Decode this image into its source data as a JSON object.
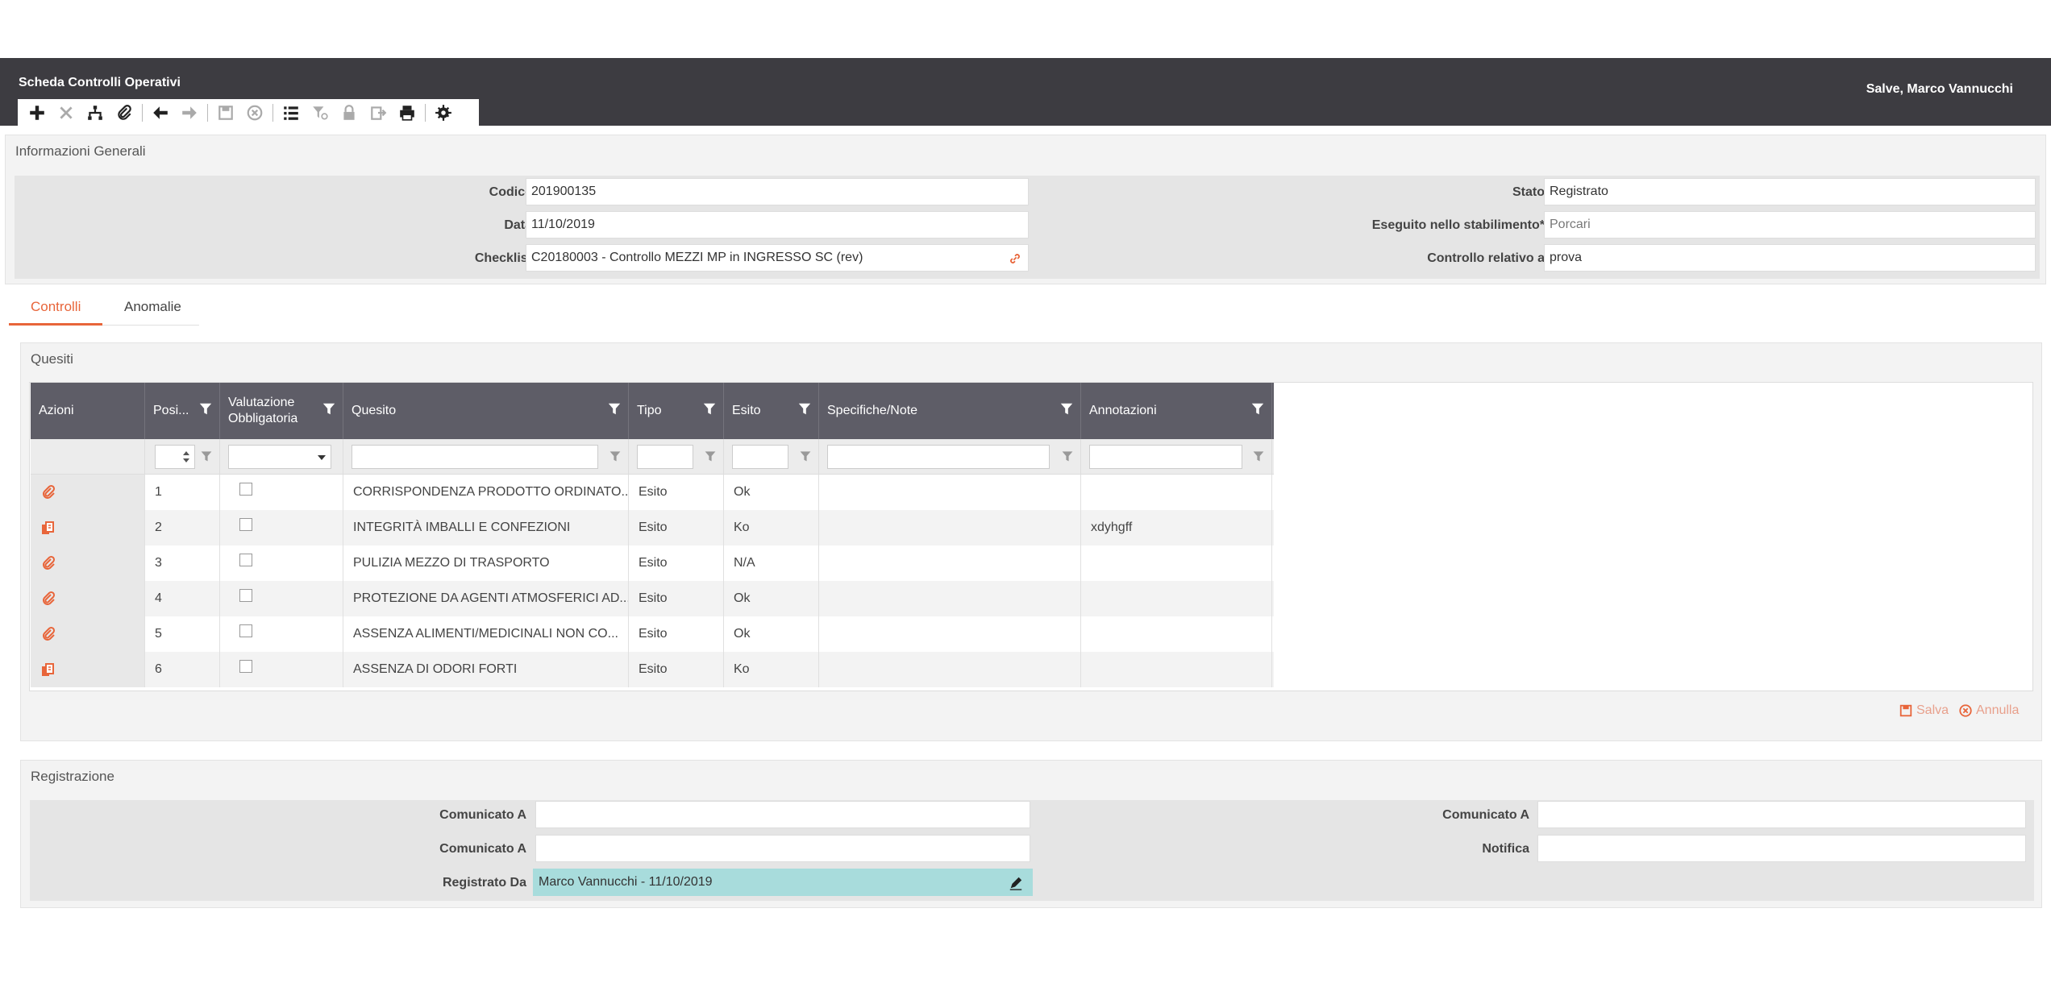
{
  "header": {
    "title": "Scheda Controlli Operativi",
    "greeting": "Salve, Marco Vannucchi"
  },
  "toolbar": {
    "icons": [
      "plus-icon",
      "close-icon",
      "hierarchy-icon",
      "paperclip-icon",
      "arrow-left-icon",
      "arrow-right-icon",
      "save-icon",
      "cancel-circle-icon",
      "list-icon",
      "filter-icon",
      "lock-icon",
      "export-icon",
      "print-icon",
      "gear-icon"
    ]
  },
  "info": {
    "section_title": "Informazioni Generali",
    "codice_label": "Codice",
    "codice_value": "201900135",
    "data_label": "Data",
    "data_value": "11/10/2019",
    "checklist_label": "Checklist",
    "checklist_value": "C20180003 - Controllo MEZZI MP in INGRESSO SC (rev)",
    "stato_label": "Stato",
    "stato_value": "Registrato",
    "stabilimento_label": "Eseguito nello stabilimento*",
    "stabilimento_value": "Porcari",
    "controllo_label": "Controllo relativo a",
    "controllo_value": "prova"
  },
  "tabs": [
    {
      "label": "Controlli",
      "active": true
    },
    {
      "label": "Anomalie",
      "active": false
    }
  ],
  "quesiti": {
    "section_title": "Quesiti",
    "columns": [
      "Azioni",
      "Posi...",
      "Valutazione Obbligatoria",
      "Quesito",
      "Tipo",
      "Esito",
      "Specifiche/Note",
      "Annotazioni"
    ],
    "rows": [
      {
        "icon": "paperclip-icon",
        "pos": "1",
        "quesito": "CORRISPONDENZA PRODOTTO ORDINATO...",
        "tipo": "Esito",
        "esito": "Ok",
        "note": "",
        "annotazioni": ""
      },
      {
        "icon": "attachment-files-icon",
        "pos": "2",
        "quesito": "INTEGRITÀ IMBALLI E CONFEZIONI",
        "tipo": "Esito",
        "esito": "Ko",
        "note": "",
        "annotazioni": "xdyhgff"
      },
      {
        "icon": "paperclip-icon",
        "pos": "3",
        "quesito": "PULIZIA MEZZO DI TRASPORTO",
        "tipo": "Esito",
        "esito": "N/A",
        "note": "",
        "annotazioni": ""
      },
      {
        "icon": "paperclip-icon",
        "pos": "4",
        "quesito": "PROTEZIONE DA AGENTI ATMOSFERICI AD...",
        "tipo": "Esito",
        "esito": "Ok",
        "note": "",
        "annotazioni": ""
      },
      {
        "icon": "paperclip-icon",
        "pos": "5",
        "quesito": "ASSENZA ALIMENTI/MEDICINALI NON CO...",
        "tipo": "Esito",
        "esito": "Ok",
        "note": "",
        "annotazioni": ""
      },
      {
        "icon": "attachment-files-icon",
        "pos": "6",
        "quesito": "ASSENZA DI ODORI FORTI",
        "tipo": "Esito",
        "esito": "Ko",
        "note": "",
        "annotazioni": ""
      }
    ],
    "save_label": "Salva",
    "cancel_label": "Annulla"
  },
  "registrazione": {
    "section_title": "Registrazione",
    "comunicato_a_1_label": "Comunicato A",
    "comunicato_a_2_label": "Comunicato A",
    "registrato_da_label": "Registrato Da",
    "registrato_da_value": "Marco Vannucchi - 11/10/2019",
    "comunicato_a_3_label": "Comunicato A",
    "notifica_label": "Notifica"
  },
  "colors": {
    "header_bg": "#3d3c41",
    "accent": "#e8653a",
    "grid_header": "#5e5d67",
    "highlight_field": "#a8dcdc"
  }
}
